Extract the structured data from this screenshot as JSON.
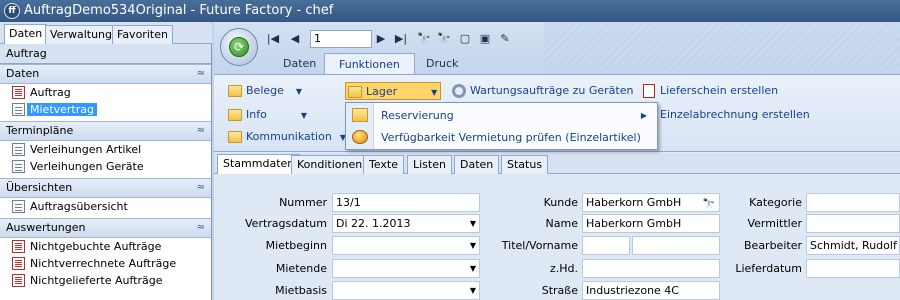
{
  "window": {
    "title": "AuftragDemo534Original - Future Factory - chef",
    "app_icon_text": "ff"
  },
  "left_panel": {
    "tabs": [
      "Daten",
      "Verwaltung",
      "Favoriten"
    ],
    "header": "Auftrag",
    "groups": [
      {
        "title": "Daten",
        "items": [
          "Auftrag",
          "Mietvertrag"
        ]
      },
      {
        "title": "Terminpläne",
        "items": [
          "Verleihungen Artikel",
          "Verleihungen Geräte"
        ]
      },
      {
        "title": "Übersichten",
        "items": [
          "Auftragsübersicht"
        ]
      },
      {
        "title": "Auswertungen",
        "items": [
          "Nichtgebuchte Aufträge",
          "Nichtverrechnete Aufträge",
          "Nichtgelieferte Aufträge"
        ]
      }
    ],
    "selected_item": "Mietvertrag",
    "collapse_glyph": "≈"
  },
  "toolbar": {
    "record_value": "1",
    "nav": {
      "first": "|◀",
      "prev": "◀",
      "next": "▶",
      "last": "▶|"
    },
    "icons": {
      "find": "🔭",
      "find_filter": "🔭",
      "new": "▢",
      "save": "▣",
      "edit": "✎"
    }
  },
  "ribbon_tabs": [
    "Daten",
    "Funktionen",
    "Druck"
  ],
  "ribbon": {
    "belege": "Belege",
    "info": "Info",
    "kommunikation": "Kommunikation",
    "lager": "Lager",
    "wartung": "Wartungsaufträge zu Geräten",
    "lieferschein": "Lieferschein erstellen",
    "einzelabrechnung": "Einzelabrechnung erstellen",
    "dropdown_glyph": "▼"
  },
  "lager_menu": {
    "items": [
      "Reservierung",
      "Verfügbarkeit Vermietung prüfen (Einzelartikel)"
    ],
    "submenu_glyph": "▶"
  },
  "form_tabs": [
    "Stammdaten",
    "Konditionen",
    "Texte",
    "Listen",
    "Daten",
    "Status"
  ],
  "form": {
    "col1": [
      {
        "label": "Nummer",
        "value": "13/1"
      },
      {
        "label": "Vertragsdatum",
        "value": "Di 22.  1.2013"
      },
      {
        "label": "Mietbeginn",
        "value": ""
      },
      {
        "label": "Mietende",
        "value": ""
      },
      {
        "label": "Mietbasis",
        "value": ""
      }
    ],
    "col2": [
      {
        "label": "Kunde",
        "value": "Haberkorn GmbH"
      },
      {
        "label": "Name",
        "value": "Haberkorn GmbH"
      },
      {
        "label": "Titel/Vorname",
        "value": ""
      },
      {
        "label": "z.Hd.",
        "value": ""
      },
      {
        "label": "Straße",
        "value": "Industriezone 4C"
      }
    ],
    "col3": [
      {
        "label": "Kategorie",
        "value": ""
      },
      {
        "label": "Vermittler",
        "value": ""
      },
      {
        "label": "Bearbeiter",
        "value": "Schmidt, Rudolf"
      },
      {
        "label": "Lieferdatum",
        "value": ""
      }
    ]
  }
}
